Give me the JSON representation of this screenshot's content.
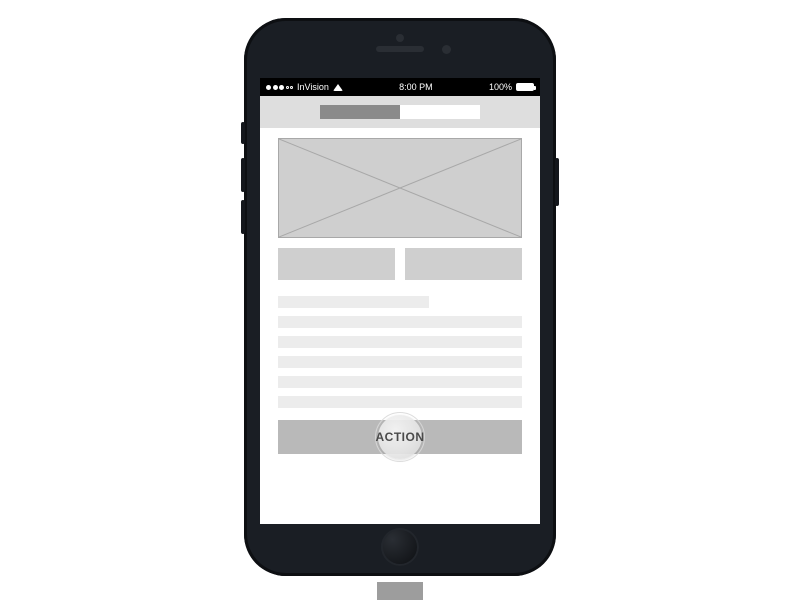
{
  "statusbar": {
    "carrier": "InVision",
    "time": "8:00 PM",
    "battery_pct": "100%"
  },
  "action": {
    "label": "ACTION"
  }
}
